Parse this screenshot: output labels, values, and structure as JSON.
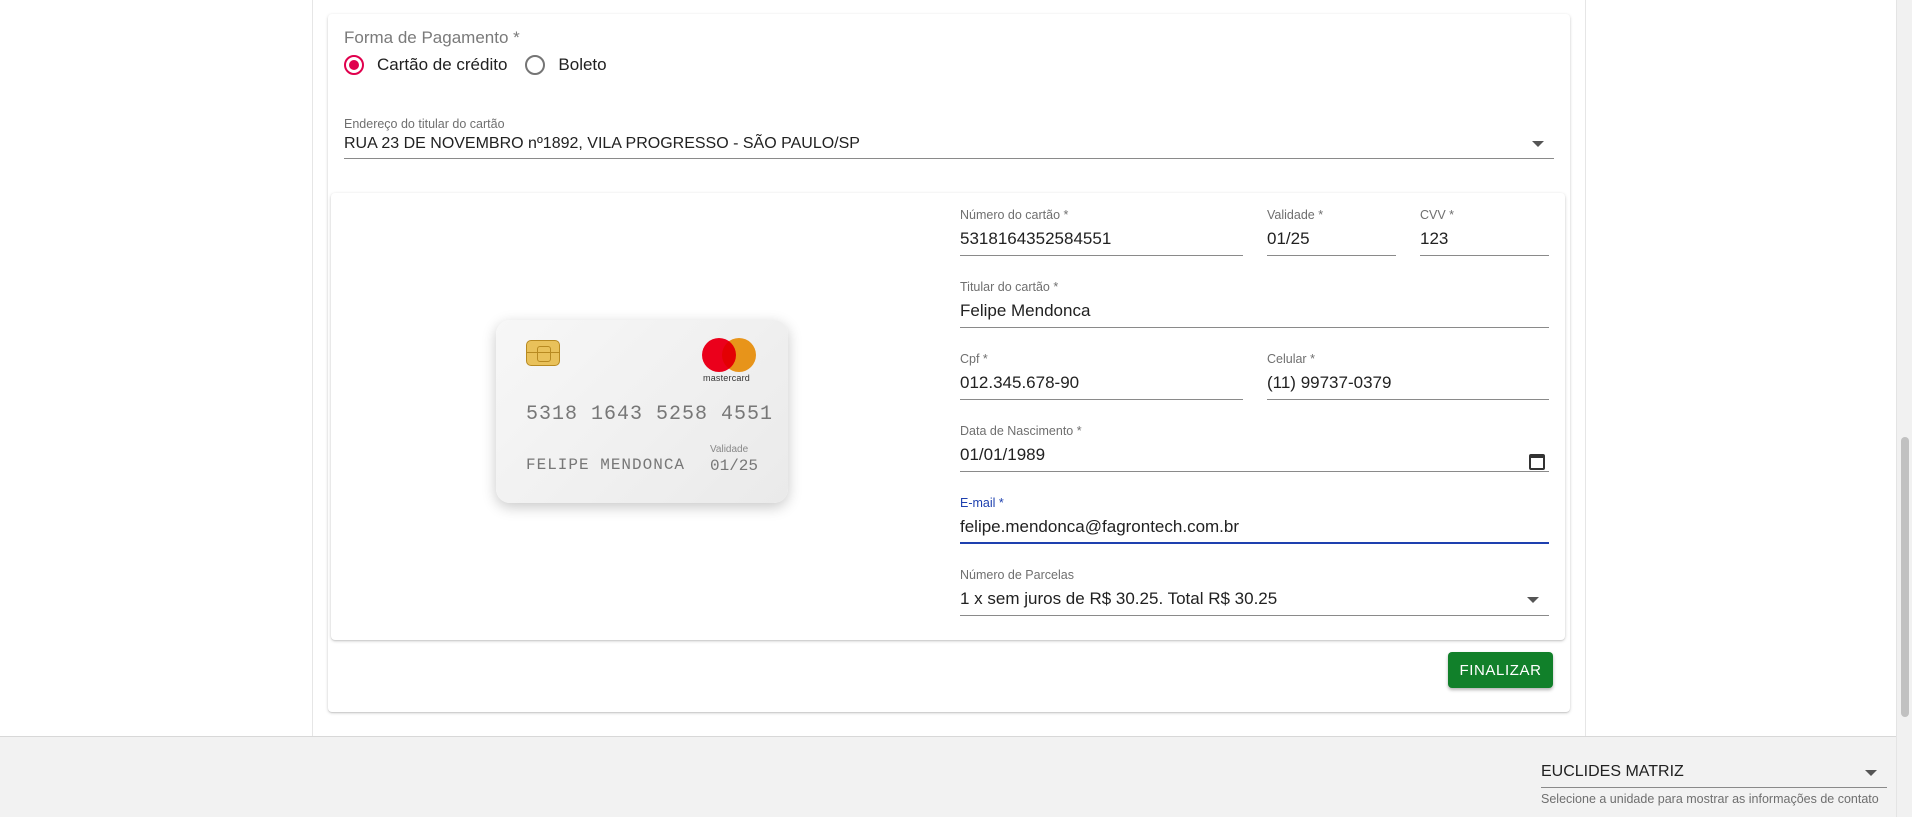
{
  "payment": {
    "method_label": "Forma de Pagamento *",
    "options": [
      {
        "label": "Cartão de crédito",
        "selected": true
      },
      {
        "label": "Boleto",
        "selected": false
      }
    ],
    "address": {
      "label": "Endereço do titular do cartão",
      "value": "RUA 23 DE NOVEMBRO nº1892, VILA PROGRESSO - SÃO PAULO/SP"
    }
  },
  "card_preview": {
    "number": "5318 1643 5258 4551",
    "holder": "FELIPE MENDONCA",
    "validity_label": "Validade",
    "validity": "01/25",
    "brand": "mastercard",
    "brand_icon": "mastercard-logo",
    "chip_icon": "card-chip-icon"
  },
  "form": {
    "card_number": {
      "label": "Número do cartão *",
      "value": "5318164352584551"
    },
    "validity": {
      "label": "Validade *",
      "value": "01/25"
    },
    "cvv": {
      "label": "CVV *",
      "value": "123"
    },
    "holder": {
      "label": "Titular do cartão *",
      "value": "Felipe Mendonca"
    },
    "cpf": {
      "label": "Cpf *",
      "value": "012.345.678-90"
    },
    "phone": {
      "label": "Celular *",
      "value": "(11) 99737-0379"
    },
    "birth": {
      "label": "Data de Nascimento *",
      "value": "01/01/1989"
    },
    "email": {
      "label": "E-mail *",
      "value": "felipe.mendonca@fagrontech.com.br"
    },
    "installments": {
      "label": "Número de Parcelas",
      "value": "1 x sem juros de R$ 30.25. Total R$ 30.25"
    }
  },
  "actions": {
    "finalize_label": "FINALIZAR"
  },
  "footer": {
    "unit_value": "EUCLIDES MATRIZ",
    "unit_hint": "Selecione a unidade para mostrar as informações de contato"
  },
  "colors": {
    "accent_radio": "#e0004d",
    "focus_blue": "#1e40af",
    "finalize_green": "#11802a"
  }
}
